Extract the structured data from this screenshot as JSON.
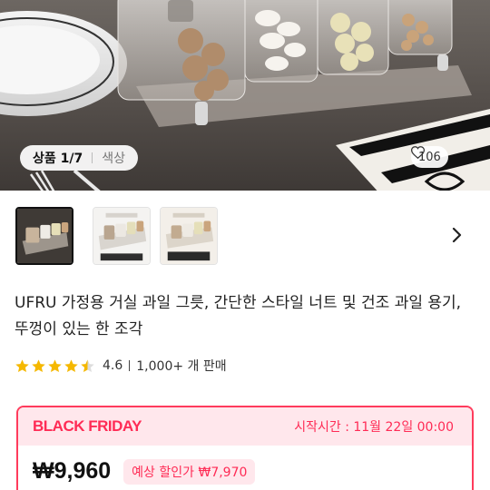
{
  "hero": {
    "tabs": {
      "active": "상품 1/7",
      "inactive": "색상"
    },
    "like_count": "106"
  },
  "thumbnails": [
    {
      "name": "thumbnail-1",
      "selected": true
    },
    {
      "name": "thumbnail-2",
      "selected": false
    },
    {
      "name": "thumbnail-3",
      "selected": false
    }
  ],
  "product": {
    "title": "UFRU 가정용 거실 과일 그릇, 간단한 스타일 너트 및 건조 과일 용기, 뚜껑이 있는 한 조각",
    "rating": {
      "stars": 4.5,
      "score": "4.6",
      "sales": "1,000+ 개 판매"
    }
  },
  "promo": {
    "label": "BLACK FRIDAY",
    "start_time": "시작시간 : 11월 22일 00:00",
    "price": "₩9,960",
    "expected_discount": "예상 할인가 ₩7,970"
  },
  "colors": {
    "accent": "#ff2b55",
    "accent_light": "#ffe7ec",
    "star": "#f5b800"
  },
  "icons": {
    "like": "heart-outline-icon",
    "next": "chevron-right-icon",
    "rating": "star-icon"
  }
}
